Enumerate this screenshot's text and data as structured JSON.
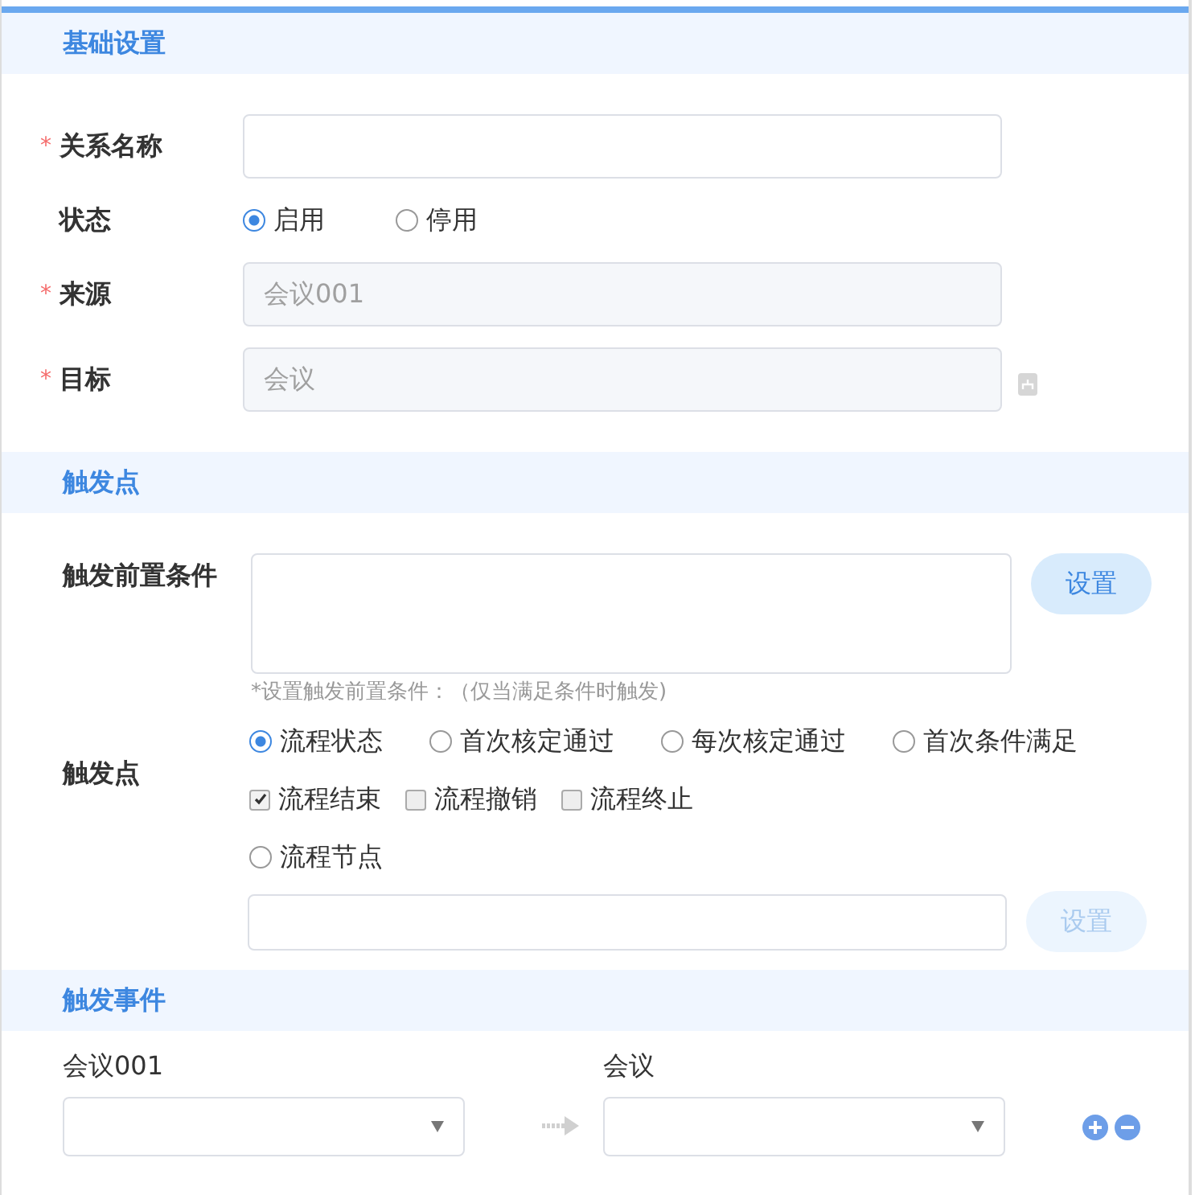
{
  "basic": {
    "title": "基础设置",
    "name_field": {
      "label": "关系名称",
      "required_mark": "*"
    },
    "status": {
      "label": "状态",
      "options": [
        {
          "label": "启用",
          "selected": true
        },
        {
          "label": "停用",
          "selected": false
        }
      ]
    },
    "source": {
      "label": "来源",
      "required_mark": "*",
      "value": "会议001",
      "disabled": true
    },
    "target": {
      "label": "目标",
      "required_mark": "*",
      "value": "会议",
      "disabled": true
    }
  },
  "trigger": {
    "title": "触发点",
    "precondition": {
      "label": "触发前置条件",
      "button": "设置",
      "button_disabled": false,
      "hint": "*设置触发前置条件：（仅当满足条件时触发)"
    },
    "point_label": "触发点",
    "points": [
      {
        "label": "流程状态",
        "selected": true
      },
      {
        "label": "首次核定通过",
        "selected": false
      },
      {
        "label": "每次核定通过",
        "selected": false
      },
      {
        "label": "首次条件满足",
        "selected": false
      }
    ],
    "flow_states": [
      {
        "label": "流程结束",
        "checked": true
      },
      {
        "label": "流程撤销",
        "checked": false
      },
      {
        "label": "流程终止",
        "checked": false
      }
    ],
    "node": {
      "label": "流程节点",
      "selected": false,
      "button": "设置",
      "button_disabled": true
    }
  },
  "event": {
    "title": "触发事件",
    "source_label": "会议001",
    "target_label": "会议"
  }
}
